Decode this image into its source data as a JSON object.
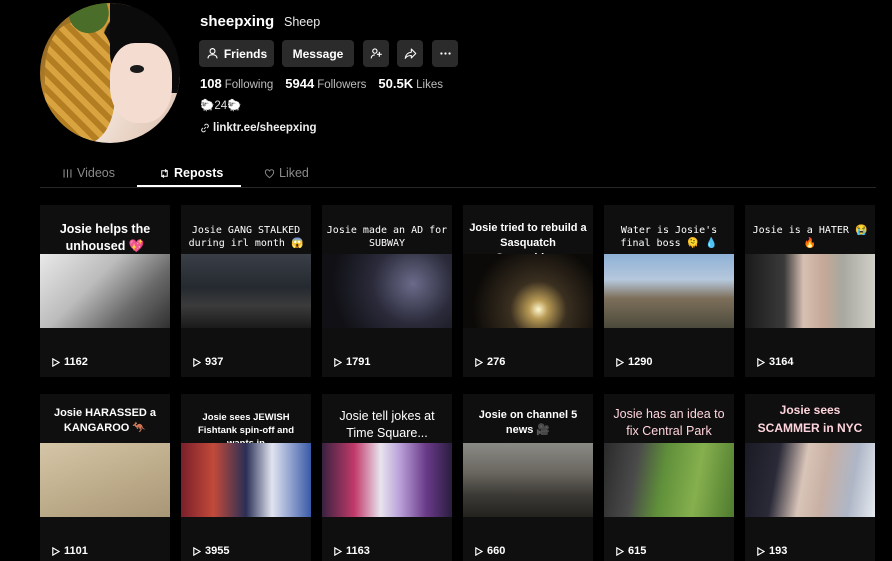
{
  "profile": {
    "username": "sheepxing",
    "nickname": "Sheep",
    "bio": "🐑24🐑",
    "link": "linktr.ee/sheepxing"
  },
  "actions": {
    "friends": "Friends",
    "message": "Message"
  },
  "stats": {
    "following_count": "108",
    "following_label": "Following",
    "followers_count": "5944",
    "followers_label": "Followers",
    "likes_count": "50.5K",
    "likes_label": "Likes"
  },
  "tabs": {
    "videos": "Videos",
    "reposts": "Reposts",
    "liked": "Liked"
  },
  "videos": [
    {
      "title": "Josie helps the unhoused 💖",
      "plays": "1162"
    },
    {
      "title": "Josie GANG STALKED during irl month 😱",
      "plays": "937"
    },
    {
      "title": "Josie made an AD for SUBWAY",
      "plays": "1791"
    },
    {
      "title": "Josie tried to rebuild a Sasquatch Spaceship...",
      "plays": "276"
    },
    {
      "title": "Water is Josie's final boss 🫠 💧",
      "plays": "1290"
    },
    {
      "title": "Josie is a HATER 😭 🔥",
      "plays": "3164"
    },
    {
      "title": "Josie HARASSED a KANGAROO 🦘",
      "plays": "1101"
    },
    {
      "title": "Josie sees JEWISH Fishtank spin-off and wants in",
      "plays": "3955"
    },
    {
      "title": "Josie tell jokes at Time Square...",
      "plays": "1163"
    },
    {
      "title": "Josie on channel 5 news 🎥",
      "plays": "660"
    },
    {
      "title": "Josie has an idea to fix Central Park",
      "plays": "615"
    },
    {
      "title": "Josie sees SCAMMER in NYC",
      "plays": "193"
    }
  ]
}
